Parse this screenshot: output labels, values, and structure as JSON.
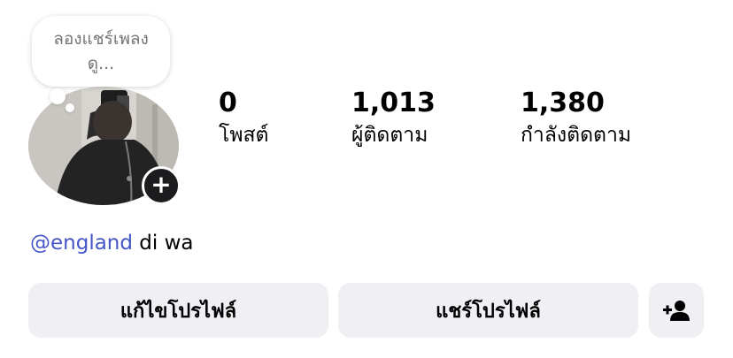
{
  "note_bubble": {
    "line1": "ลองแชร์เพลง",
    "line2": "ดู..."
  },
  "stats": [
    {
      "value": "0",
      "label": "โพสต์"
    },
    {
      "value": "1,013",
      "label": "ผู้ติดตาม"
    },
    {
      "value": "1,380",
      "label": "กำลังติดตาม"
    }
  ],
  "bio": {
    "mention": "@england",
    "text": " di wa"
  },
  "buttons": {
    "edit_profile": "แก้ไขโปรไฟล์",
    "share_profile": "แชร์โปรไฟล์"
  },
  "icons": {
    "add_story": "plus-icon",
    "add_person": "add-person-icon"
  }
}
